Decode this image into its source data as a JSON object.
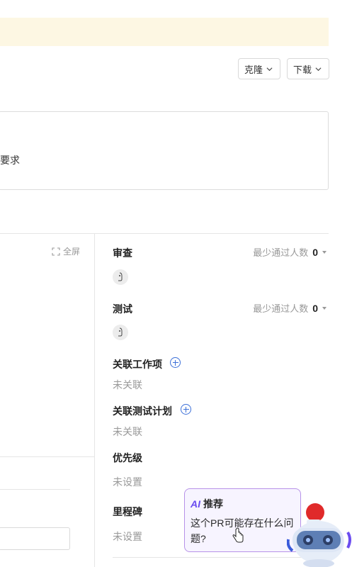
{
  "header": {
    "clone_label": "克隆",
    "download_label": "下载"
  },
  "description": {
    "text_fragment": "要求"
  },
  "diff_panel": {
    "fullscreen_label": "全屏"
  },
  "sidebar": {
    "review": {
      "title": "审查",
      "min_pass_label": "最少通过人数",
      "min_pass_value": "0"
    },
    "test": {
      "title": "测试",
      "min_pass_label": "最少通过人数",
      "min_pass_value": "0"
    },
    "linked_work_items": {
      "title": "关联工作项",
      "value": "未关联"
    },
    "linked_test_plan": {
      "title": "关联测试计划",
      "value": "未关联"
    },
    "priority": {
      "title": "优先级",
      "value": "未设置"
    },
    "milestone": {
      "title": "里程碑",
      "value": "未设置"
    }
  },
  "ai_recommend": {
    "badge": "AI",
    "title": "推荐",
    "question": "这个PR可能存在什么问题?"
  },
  "colors": {
    "banner": "#fdf7e3",
    "accent": "#3b6fd8",
    "ai_border": "#b792e8"
  }
}
